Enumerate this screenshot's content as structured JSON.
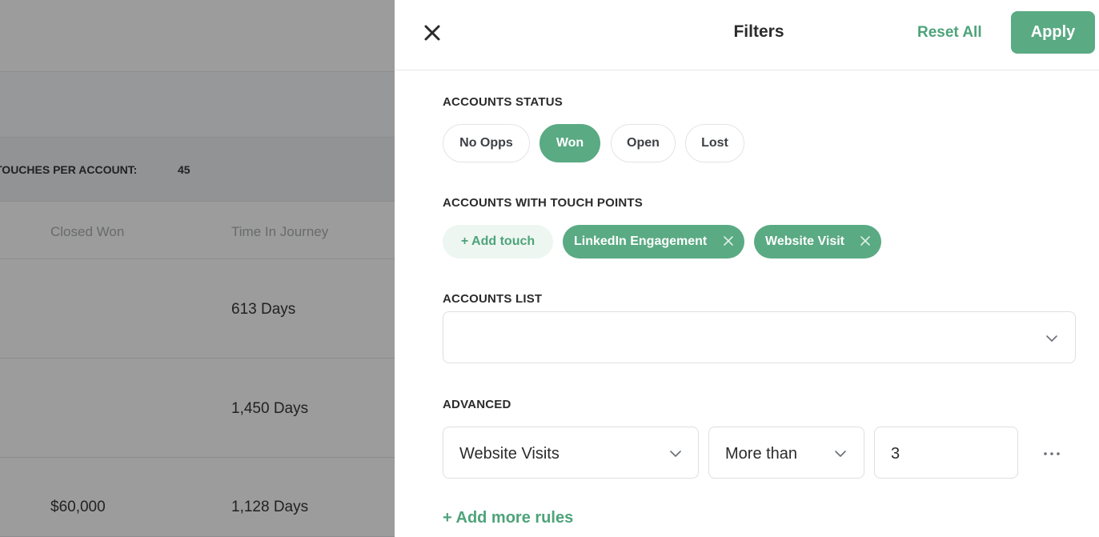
{
  "background": {
    "summary_label": "TOUCHES PER ACCOUNT:",
    "summary_value": "45",
    "columns": [
      "Closed Won",
      "Time In Journey"
    ],
    "rows": [
      {
        "closed_won": "",
        "time": "613 Days"
      },
      {
        "closed_won": "",
        "time": "1,450 Days"
      },
      {
        "closed_won": "$60,000",
        "time": "1,128 Days"
      }
    ]
  },
  "panel": {
    "title": "Filters",
    "reset_label": "Reset All",
    "apply_label": "Apply"
  },
  "accounts_status": {
    "label": "ACCOUNTS STATUS",
    "options": [
      {
        "label": "No Opps",
        "active": false
      },
      {
        "label": "Won",
        "active": true
      },
      {
        "label": "Open",
        "active": false
      },
      {
        "label": "Lost",
        "active": false
      }
    ]
  },
  "touch_points": {
    "label": "ACCOUNTS WITH TOUCH POINTS",
    "add_label": "+ Add touch",
    "tags": [
      "LinkedIn Engagement",
      "Website Visit"
    ]
  },
  "accounts_list": {
    "label": "ACCOUNTS LIST",
    "value": ""
  },
  "advanced": {
    "label": "ADVANCED",
    "rule": {
      "metric": "Website Visits",
      "operator": "More than",
      "value": "3"
    },
    "add_more_label": "+ Add more rules"
  },
  "colors": {
    "accent": "#5aaa83",
    "accent_text": "#4ea37a",
    "overlay": "rgba(20,20,20,0.42)"
  },
  "icons": {
    "close": "close-icon",
    "remove": "x-icon",
    "dropdown": "chevron-down-icon",
    "more": "more-horizontal-icon"
  }
}
